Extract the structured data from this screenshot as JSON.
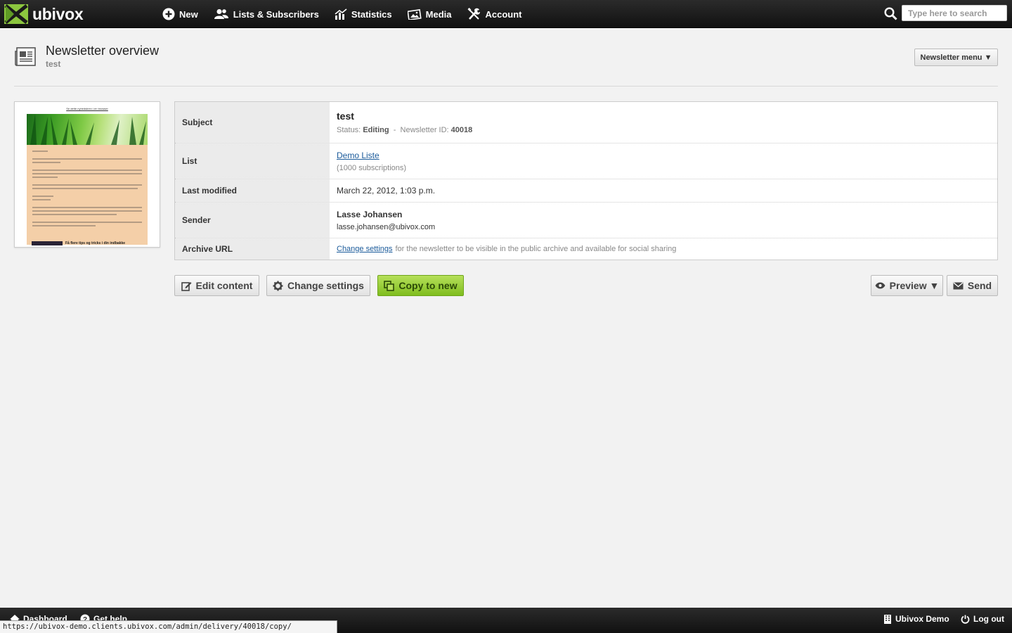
{
  "app": {
    "logo_text": "ubivox"
  },
  "nav": {
    "items": [
      {
        "label": "New",
        "icon": "plus-circle-icon"
      },
      {
        "label": "Lists & Subscribers",
        "icon": "users-icon"
      },
      {
        "label": "Statistics",
        "icon": "bar-chart-icon"
      },
      {
        "label": "Media",
        "icon": "images-icon"
      },
      {
        "label": "Account",
        "icon": "tools-icon"
      }
    ]
  },
  "search": {
    "placeholder": "Type here to search",
    "value": ""
  },
  "page": {
    "title": "Newsletter overview",
    "subtitle": "test",
    "menu_label": "Newsletter menu ▼"
  },
  "thumbnail": {
    "link_text": "Se dette nyhedsbrev i en browser",
    "footer_text": "Få flere tips og tricks i din indbakke"
  },
  "details": {
    "subject": {
      "label": "Subject",
      "value": "test",
      "status_label": "Status:",
      "status_value": "Editing",
      "separator": "-",
      "id_label": "Newsletter ID:",
      "id_value": "40018"
    },
    "list": {
      "label": "List",
      "name": "Demo Liste",
      "subscriptions": "(1000 subscriptions)"
    },
    "last_modified": {
      "label": "Last modified",
      "value": "March 22, 2012, 1:03 p.m."
    },
    "sender": {
      "label": "Sender",
      "name": "Lasse Johansen",
      "email": "lasse.johansen@ubivox.com"
    },
    "archive_url": {
      "label": "Archive URL",
      "link_text": "Change settings",
      "text": "for the newsletter to be visible in the public archive and available for social sharing"
    }
  },
  "actions": {
    "edit_content": "Edit content",
    "change_settings": "Change settings",
    "copy_to_new": "Copy to new",
    "preview": "Preview ▼",
    "send": "Send"
  },
  "footer": {
    "dashboard": "Dashboard",
    "get_help": "Get help",
    "account_name": "Ubivox Demo",
    "logout": "Log out"
  },
  "status_url": "https://ubivox-demo.clients.ubivox.com/admin/delivery/40018/copy/",
  "colors": {
    "accent_green": "#7fbd1f",
    "logo_green": "#8cc63f",
    "link_blue": "#1a5a9a"
  }
}
